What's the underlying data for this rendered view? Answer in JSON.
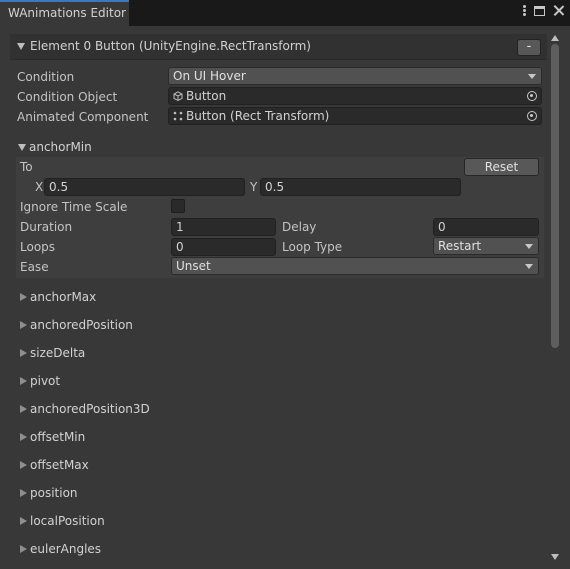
{
  "window": {
    "tab_title": "WAnimations Editor",
    "controls": {
      "menu_icon": "kebab-menu-icon",
      "maximize_icon": "maximize-icon",
      "close_icon": "close-icon"
    }
  },
  "element": {
    "title": "Element 0 Button (UnityEngine.RectTransform)",
    "remove_label": "-"
  },
  "fields": {
    "condition": {
      "label": "Condition",
      "value": "On UI Hover"
    },
    "condition_object": {
      "label": "Condition Object",
      "value": "Button",
      "icon": "gameobject-cube-icon"
    },
    "animated_component": {
      "label": "Animated Component",
      "value": "Button (Rect Transform)",
      "icon": "rect-transform-icon"
    }
  },
  "anchor_min": {
    "label": "anchorMin",
    "to_label": "To",
    "reset_label": "Reset",
    "x_label": "X",
    "x_value": "0.5",
    "y_label": "Y",
    "y_value": "0.5",
    "ignore_time_scale_label": "Ignore Time Scale",
    "ignore_time_scale_checked": false,
    "duration_label": "Duration",
    "duration_value": "1",
    "delay_label": "Delay",
    "delay_value": "0",
    "loops_label": "Loops",
    "loops_value": "0",
    "loop_type_label": "Loop Type",
    "loop_type_value": "Restart",
    "ease_label": "Ease",
    "ease_value": "Unset"
  },
  "properties": [
    "anchorMax",
    "anchoredPosition",
    "sizeDelta",
    "pivot",
    "anchoredPosition3D",
    "offsetMin",
    "offsetMax",
    "position",
    "localPosition",
    "eulerAngles"
  ],
  "colors": {
    "panel_bg": "#383838",
    "tab_accent": "#3a79bb",
    "field_bg": "#2a2a2a",
    "dropdown_bg": "#515151"
  }
}
